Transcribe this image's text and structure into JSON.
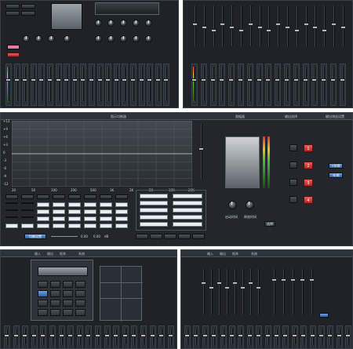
{
  "window_title": "",
  "eq_panel": {
    "title": "图示均衡器",
    "y_ticks": [
      "+12",
      "+9",
      "+6",
      "+3",
      "0",
      "-3",
      "-6",
      "-9",
      "-12"
    ],
    "x_ticks": [
      "20",
      "50",
      "100",
      "200",
      "500",
      "1K",
      "2K",
      "5K",
      "10K",
      "20K"
    ],
    "preset_button": "均衡设置",
    "freq_value": "0.00",
    "gain_value": "0.00",
    "unit_label": "dB"
  },
  "limiter_panel": {
    "title": "限幅器",
    "attack_label": "启动时间",
    "release_label": "释放时间",
    "button": "选择"
  },
  "output_select": {
    "title": "输出选择",
    "buttons": [
      "1",
      "2",
      "3",
      "4"
    ]
  },
  "output_gain": {
    "title": "输出增益设置",
    "buttons": [
      "+0dB",
      "-6dB"
    ]
  },
  "colors": {
    "accent_red": "#d93434",
    "accent_blue": "#3d7fd6",
    "panel_bg": "#1f2328",
    "meter_green": "#4bbd3c"
  },
  "bottom_left": {
    "tabs": [
      "输入",
      "输出",
      "矩阵",
      "系统"
    ]
  },
  "bottom_right": {
    "tabs": [
      "输入",
      "输出",
      "矩阵",
      "系统"
    ]
  }
}
